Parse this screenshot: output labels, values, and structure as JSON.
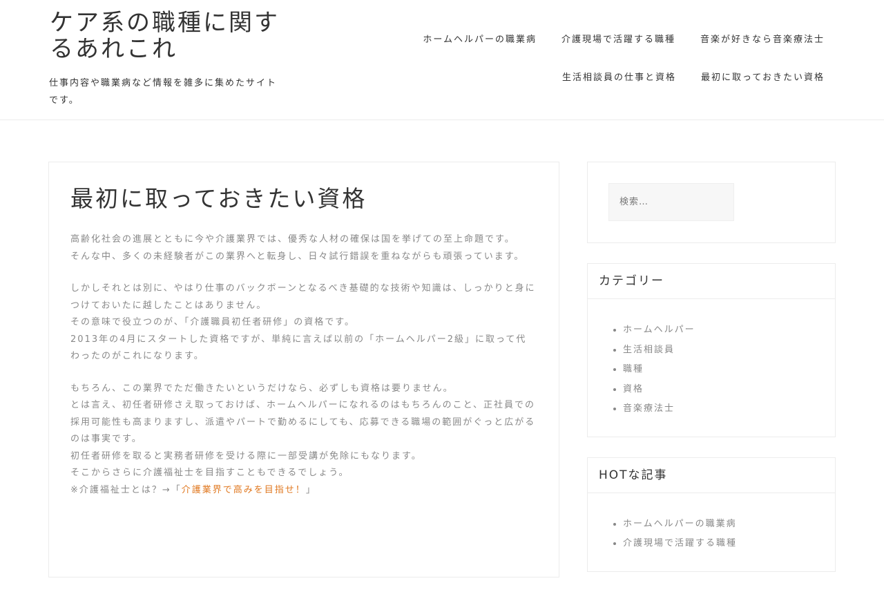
{
  "header": {
    "site_title": "ケア系の職種に関するあれこれ",
    "tagline": "仕事内容や職業病など情報を雑多に集めたサイトです。"
  },
  "nav": {
    "items": [
      {
        "label": "ホームヘルパーの職業病"
      },
      {
        "label": "介護現場で活躍する職種"
      },
      {
        "label": "音楽が好きなら音楽療法士"
      },
      {
        "label": "生活相談員の仕事と資格"
      },
      {
        "label": "最初に取っておきたい資格"
      }
    ]
  },
  "article": {
    "title": "最初に取っておきたい資格",
    "p1_l1": "高齢化社会の進展とともに今や介護業界では、優秀な人材の確保は国を挙げての至上命題です。",
    "p1_l2": "そんな中、多くの未経験者がこの業界へと転身し、日々試行錯誤を重ねながらも頑張っています。",
    "p2_l1": "しかしそれとは別に、やはり仕事のバックボーンとなるべき基礎的な技術や知識は、しっかりと身につけておいたに越したことはありません。",
    "p2_l2": "その意味で役立つのが、「介護職員初任者研修」の資格です。",
    "p2_l3": "2013年の4月にスタートした資格ですが、単純に言えば以前の「ホームヘルパー2級」に取って代わったのがこれになります。",
    "p3_l1": "もちろん、この業界でただ働きたいというだけなら、必ずしも資格は要りません。",
    "p3_l2": "とは言え、初任者研修さえ取っておけば、ホームヘルパーになれるのはもちろんのこと、正社員での採用可能性も高まりますし、派遣やパートで勤めるにしても、応募できる職場の範囲がぐっと広がるのは事実です。",
    "p3_l3": "初任者研修を取ると実務者研修を受ける際に一部受講が免除にもなります。",
    "p3_l4": "そこからさらに介護福祉士を目指すこともできるでしょう。",
    "p3_l5_prefix": "※介護福祉士とは？→「",
    "p3_l5_link": "介護業界で高みを目指せ！",
    "p3_l5_suffix": "」"
  },
  "search": {
    "placeholder": "検索…"
  },
  "categories": {
    "title": "カテゴリー",
    "items": [
      "ホームヘルパー",
      "生活相談員",
      "職種",
      "資格",
      "音楽療法士"
    ]
  },
  "hot": {
    "title": "HOTな記事",
    "items": [
      "ホームヘルパーの職業病",
      "介護現場で活躍する職種"
    ]
  },
  "colors": {
    "link": "#e07820",
    "text_muted": "#888888",
    "heading": "#333333"
  }
}
